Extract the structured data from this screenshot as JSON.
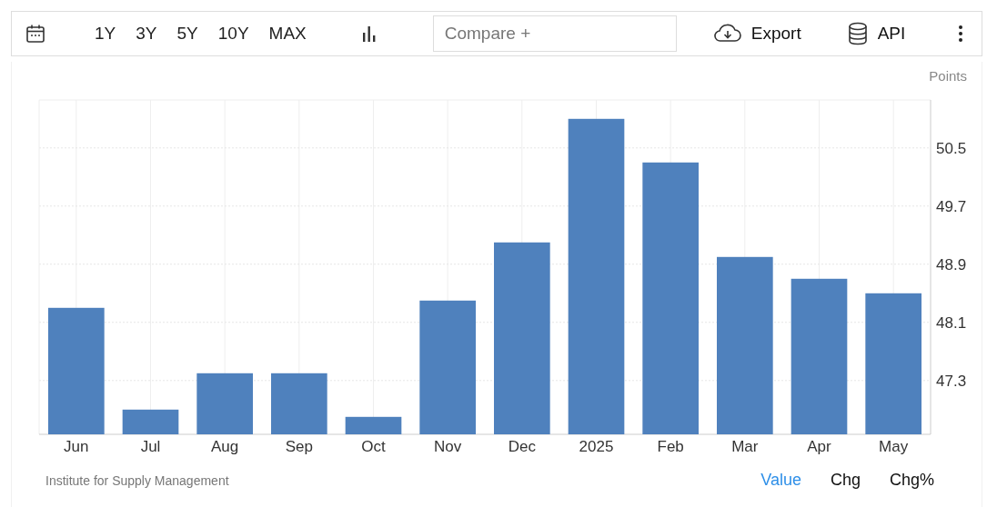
{
  "toolbar": {
    "ranges": [
      "1Y",
      "3Y",
      "5Y",
      "10Y",
      "MAX"
    ],
    "compare": {
      "placeholder": "Compare +"
    },
    "export": "Export",
    "api": "API"
  },
  "chart": {
    "unit": "Points",
    "chart_data": {
      "type": "bar",
      "categories": [
        "Jun",
        "Jul",
        "Aug",
        "Sep",
        "Oct",
        "Nov",
        "Dec",
        "2025",
        "Feb",
        "Mar",
        "Apr",
        "May"
      ],
      "grid": true,
      "series": [
        {
          "color": "#4f81bd",
          "values": [
            48.3,
            46.9,
            47.4,
            47.4,
            46.8,
            48.4,
            49.2,
            50.9,
            50.3,
            49.0,
            48.7,
            48.5
          ]
        }
      ],
      "ylim": [
        46.56,
        51.16
      ],
      "yticks": [
        {
          "value": 47.3,
          "label": "47.3"
        },
        {
          "value": 48.1,
          "label": "48.1"
        },
        {
          "value": 48.9,
          "label": "48.9"
        },
        {
          "value": 49.7,
          "label": "49.7"
        },
        {
          "value": 50.5,
          "label": "50.5"
        }
      ]
    }
  },
  "footer": {
    "source": "Institute for Supply Management",
    "tabs": [
      {
        "label": "Value",
        "selected": true
      },
      {
        "label": "Chg",
        "selected": false
      },
      {
        "label": "Chg%",
        "selected": false
      }
    ]
  }
}
